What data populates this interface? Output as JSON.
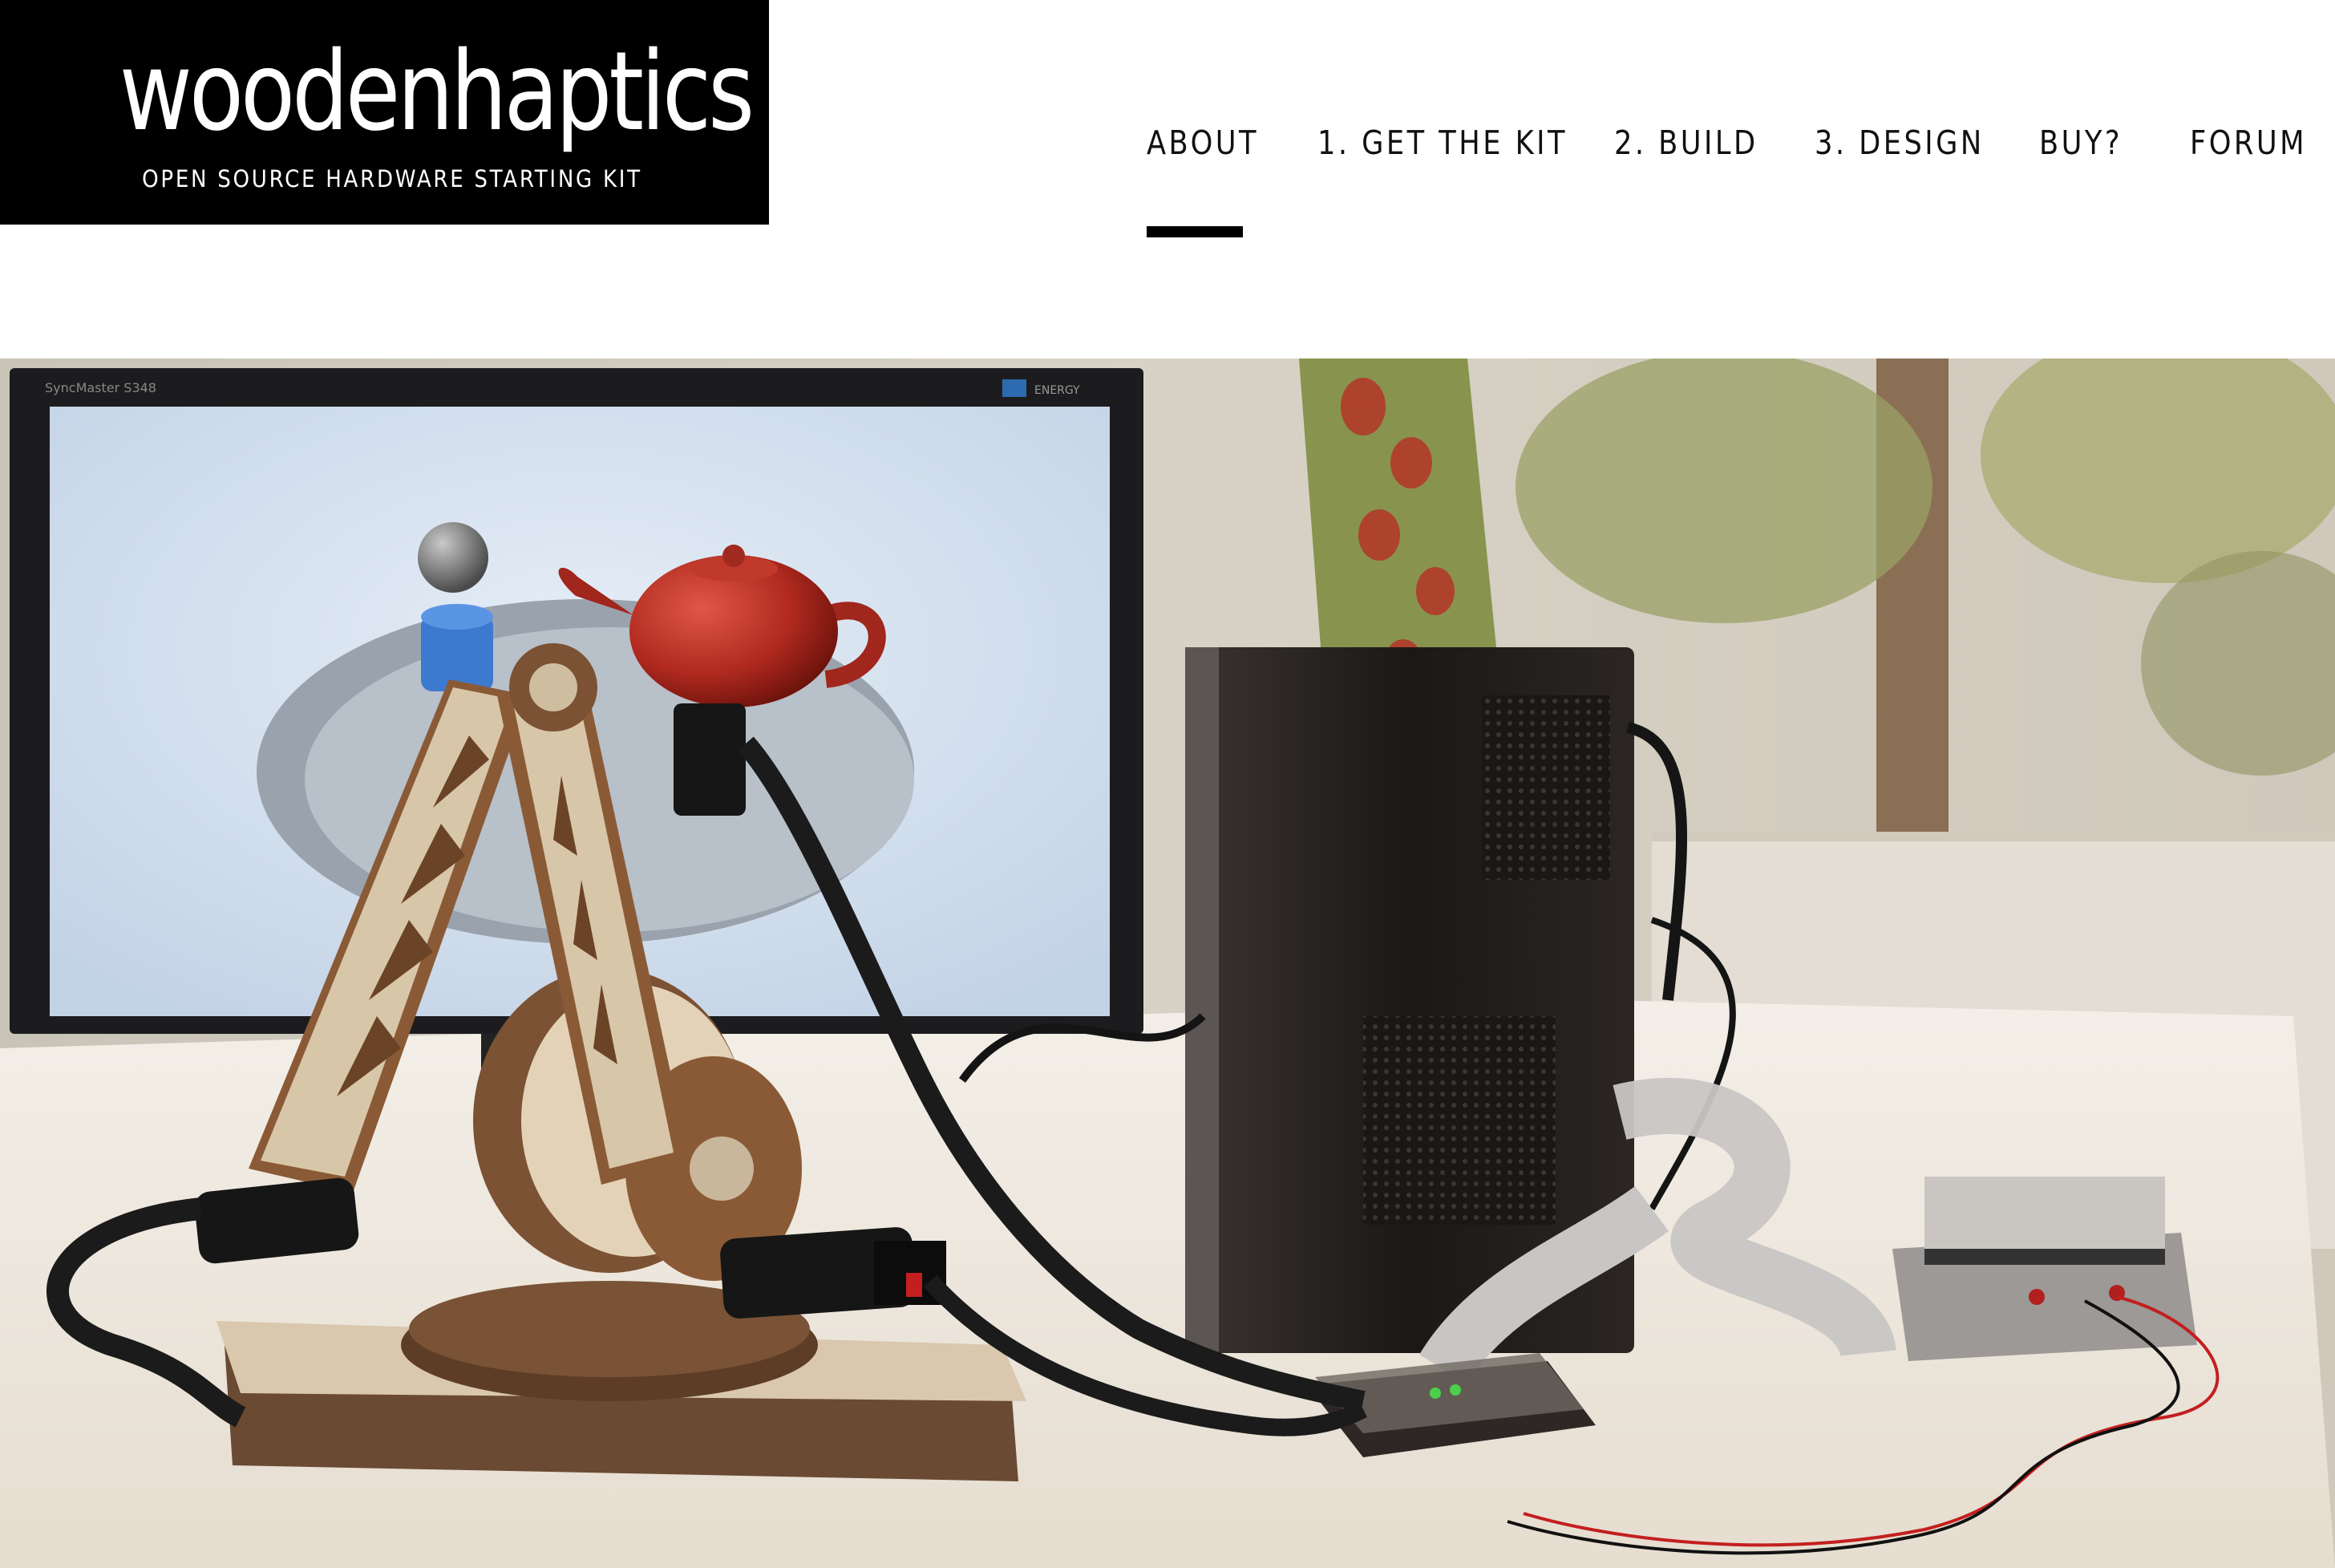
{
  "logo": {
    "title": "woodenhaptics",
    "tagline": "OPEN SOURCE HARDWARE STARTING KIT"
  },
  "nav": {
    "items": [
      {
        "label": "ABOUT",
        "active": true
      },
      {
        "label": "1. GET THE KIT",
        "active": false
      },
      {
        "label": "2. BUILD",
        "active": false
      },
      {
        "label": "3. DESIGN",
        "active": false
      },
      {
        "label": "BUY?",
        "active": false
      },
      {
        "label": "FORUM",
        "active": false
      }
    ]
  },
  "hero": {
    "monitor_brand": "SyncMaster S348",
    "monitor_badge": "ENERGY"
  },
  "colors": {
    "logo_bg": "#000000",
    "nav_text": "#111111",
    "active_underline": "#000000",
    "teapot": "#b22a1f",
    "wood": "#8a5a36"
  }
}
